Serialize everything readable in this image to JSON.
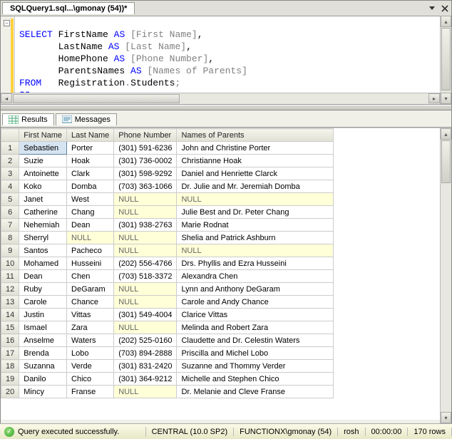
{
  "tab": {
    "title": "SQLQuery1.sql...\\gmonay (54))*"
  },
  "code_tokens": [
    {
      "t": "SELECT",
      "c": "kw"
    },
    {
      "t": " FirstName "
    },
    {
      "t": "AS",
      "c": "kw"
    },
    {
      "t": " "
    },
    {
      "t": "[First Name]",
      "c": "gray"
    },
    {
      "t": ",\n"
    },
    {
      "t": "       LastName "
    },
    {
      "t": "AS",
      "c": "kw"
    },
    {
      "t": " "
    },
    {
      "t": "[Last Name]",
      "c": "gray"
    },
    {
      "t": ",\n"
    },
    {
      "t": "       HomePhone "
    },
    {
      "t": "AS",
      "c": "kw"
    },
    {
      "t": " "
    },
    {
      "t": "[Phone Number]",
      "c": "gray"
    },
    {
      "t": ",\n"
    },
    {
      "t": "       ParentsNames "
    },
    {
      "t": "AS",
      "c": "kw"
    },
    {
      "t": " "
    },
    {
      "t": "[Names of Parents]",
      "c": "gray"
    },
    {
      "t": "\n"
    },
    {
      "t": "FROM",
      "c": "kw"
    },
    {
      "t": "   Registration"
    },
    {
      "t": ".",
      "c": "gray"
    },
    {
      "t": "Students"
    },
    {
      "t": ";",
      "c": "gray"
    },
    {
      "t": "\n"
    },
    {
      "t": "GO",
      "c": "kw"
    }
  ],
  "results_tabs": {
    "results": "Results",
    "messages": "Messages"
  },
  "columns": [
    "First Name",
    "Last Name",
    "Phone Number",
    "Names of Parents"
  ],
  "rows": [
    [
      "Sebastien",
      "Porter",
      "(301) 591-6236",
      "John and Christine Porter"
    ],
    [
      "Suzie",
      "Hoak",
      "(301) 736-0002",
      "Christianne Hoak"
    ],
    [
      "Antoinette",
      "Clark",
      "(301) 598-9292",
      "Daniel and Henriette Clarck"
    ],
    [
      "Koko",
      "Domba",
      "(703) 363-1066",
      "Dr. Julie and Mr. Jeremiah Domba"
    ],
    [
      "Janet",
      "West",
      null,
      null
    ],
    [
      "Catherine",
      "Chang",
      null,
      "Julie Best and Dr. Peter Chang"
    ],
    [
      "Nehemiah",
      "Dean",
      "(301) 938-2763",
      "Marie Rodnat"
    ],
    [
      "Sherryl",
      null,
      null,
      "Shelia and Patrick Ashburn"
    ],
    [
      "Santos",
      "Pacheco",
      null,
      null
    ],
    [
      "Mohamed",
      "Husseini",
      "(202) 556-4766",
      "Drs. Phyllis and Ezra Husseini"
    ],
    [
      "Dean",
      "Chen",
      "(703) 518-3372",
      "Alexandra Chen"
    ],
    [
      "Ruby",
      "DeGaram",
      null,
      "Lynn and Anthony DeGaram"
    ],
    [
      "Carole",
      "Chance",
      null,
      "Carole and Andy Chance"
    ],
    [
      "Justin",
      "Vittas",
      "(301) 549-4004",
      "Clarice Vittas"
    ],
    [
      "Ismael",
      "Zara",
      null,
      "Melinda and Robert Zara"
    ],
    [
      "Anselme",
      "Waters",
      "(202) 525-0160",
      "Claudette and Dr. Celestin Waters"
    ],
    [
      "Brenda",
      "Lobo",
      "(703) 894-2888",
      "Priscilla and Michel Lobo"
    ],
    [
      "Suzanna",
      "Verde",
      "(301) 831-2420",
      "Suzanne and Thommy Verder"
    ],
    [
      "Danilo",
      "Chico",
      "(301) 364-9212",
      "Michelle and Stephen Chico"
    ],
    [
      "Mincy",
      "Franse",
      null,
      "Dr. Melanie and Cleve Franse"
    ]
  ],
  "null_label": "NULL",
  "status": {
    "message": "Query executed successfully.",
    "server": "CENTRAL (10.0 SP2)",
    "login": "FUNCTIONX\\gmonay (54)",
    "db": "rosh",
    "time": "00:00:00",
    "rows": "170 rows"
  }
}
